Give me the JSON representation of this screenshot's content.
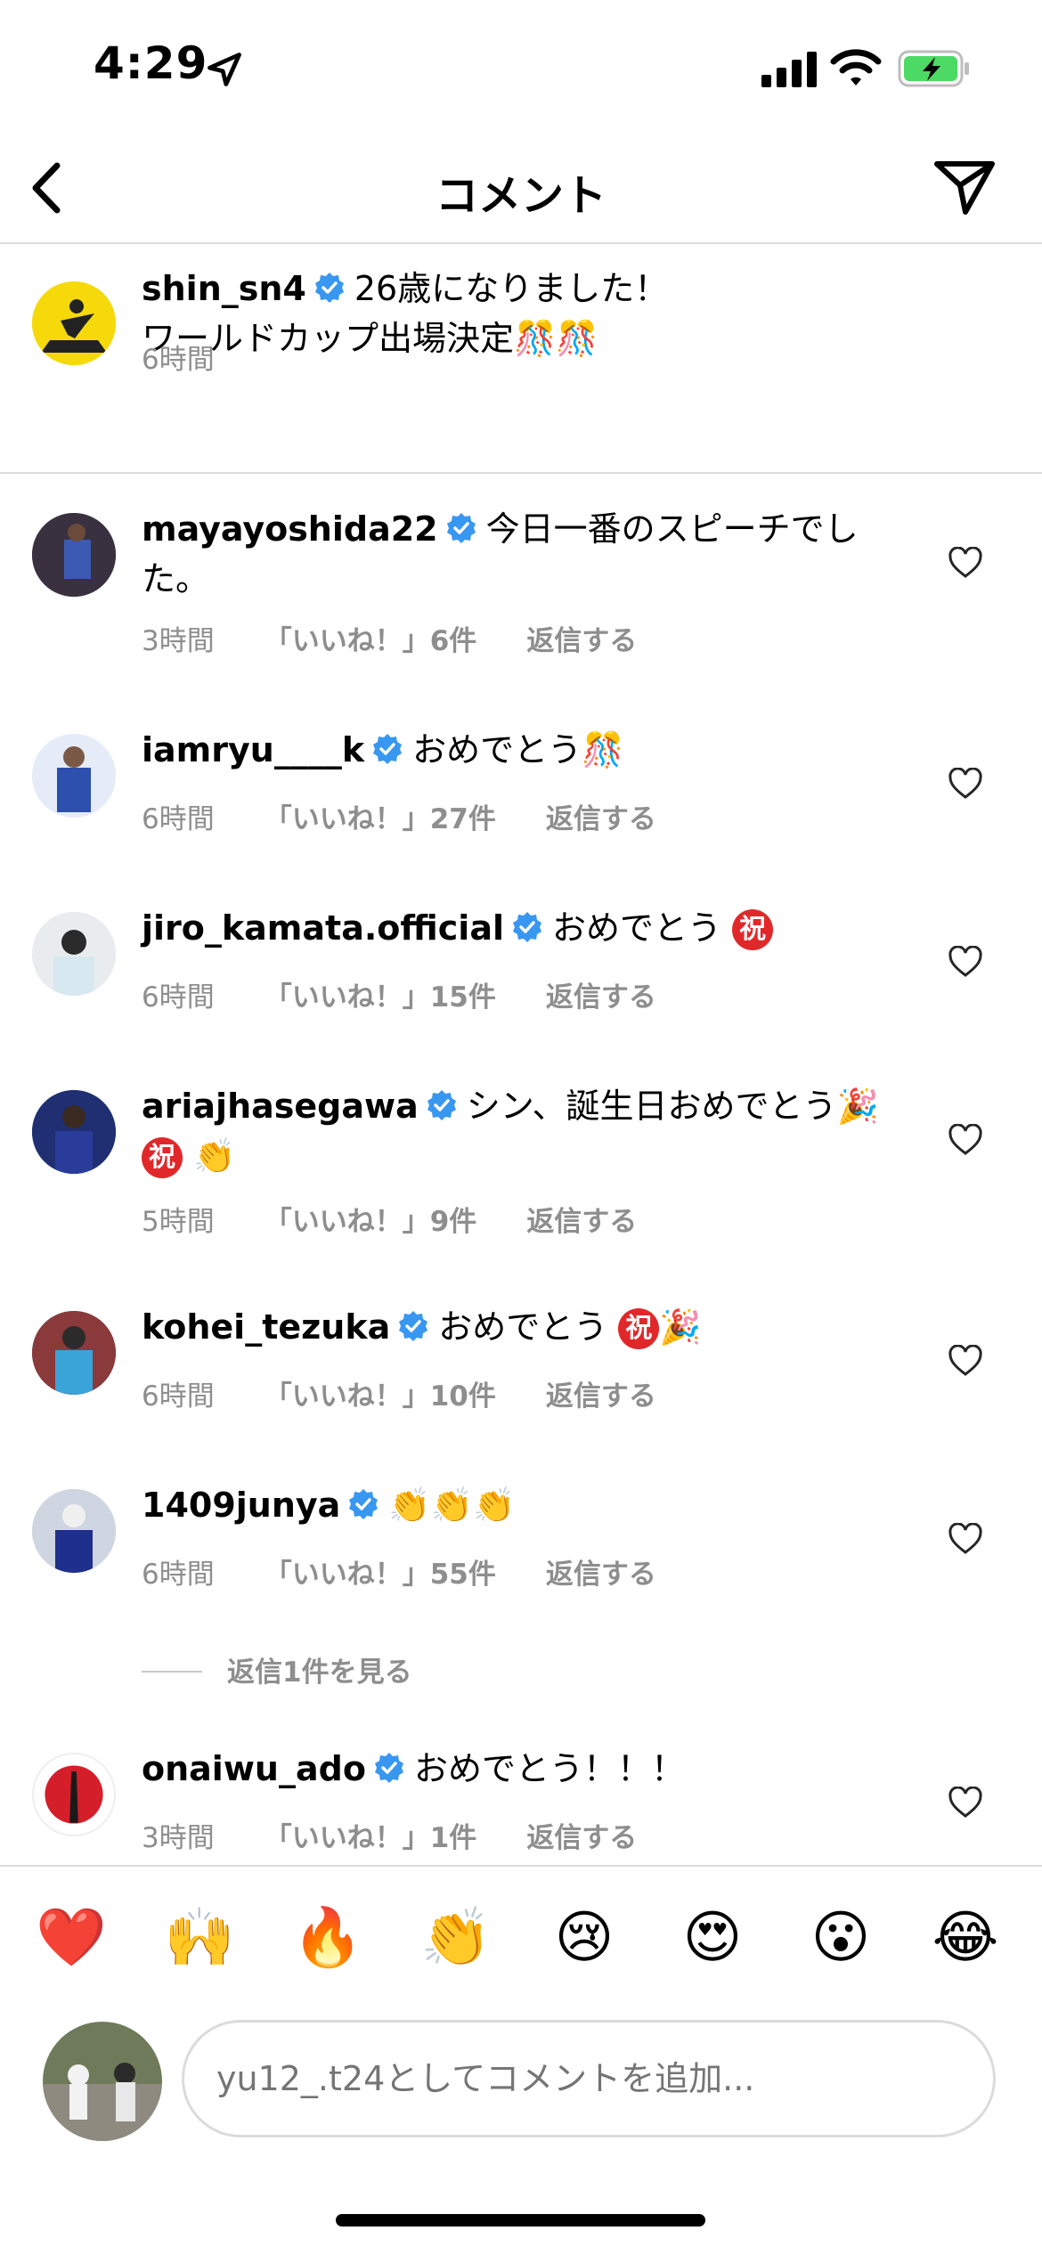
{
  "status": {
    "time": "4:29"
  },
  "header": {
    "title": "コメント"
  },
  "caption": {
    "username": "shin_sn4",
    "line1": "26歳になりました！",
    "line2": "ワールドカップ出場決定",
    "line2_emoji": "🎊🎊",
    "time": "6時間"
  },
  "comments": [
    {
      "username": "mayayoshida22",
      "text": "今日一番のスピーチでした。",
      "time": "3時間",
      "likes": "「いいね！」6件",
      "reply": "返信する"
    },
    {
      "username": "iamryu____k",
      "text": "おめでとう🎊",
      "time": "6時間",
      "likes": "「いいね！」27件",
      "reply": "返信する"
    },
    {
      "username": "jiro_kamata.official",
      "text": "おめでとう",
      "time": "6時間",
      "likes": "「いいね！」15件",
      "reply": "返信する"
    },
    {
      "username": "ariajhasegawa",
      "text": "シン、誕生日おめでとう🎉",
      "text_emoji": "👏",
      "time": "5時間",
      "likes": "「いいね！」9件",
      "reply": "返信する"
    },
    {
      "username": "kohei_tezuka",
      "text": "おめでとう",
      "text_emoji": "🎉",
      "time": "6時間",
      "likes": "「いいね！」10件",
      "reply": "返信する"
    },
    {
      "username": "1409junya",
      "text": "👏👏👏",
      "time": "6時間",
      "likes": "「いいね！」55件",
      "reply": "返信する"
    },
    {
      "username": "onaiwu_ado",
      "text": "おめでとう！！！",
      "time": "3時間",
      "likes": "「いいね！」1件",
      "reply": "返信する"
    }
  ],
  "iwai_glyph": "祝",
  "view_replies": "返信1件を見る",
  "emoji_bar": [
    "❤️",
    "🙌",
    "🔥",
    "👏",
    "😢",
    "😍",
    "😮",
    "😂"
  ],
  "composer": {
    "placeholder": "yu12_.t24としてコメントを追加..."
  },
  "colors": {
    "verified": "#3897f0",
    "meta": "#8e8e8e",
    "divider": "#dbdbdb",
    "battery": "#4cd964"
  }
}
